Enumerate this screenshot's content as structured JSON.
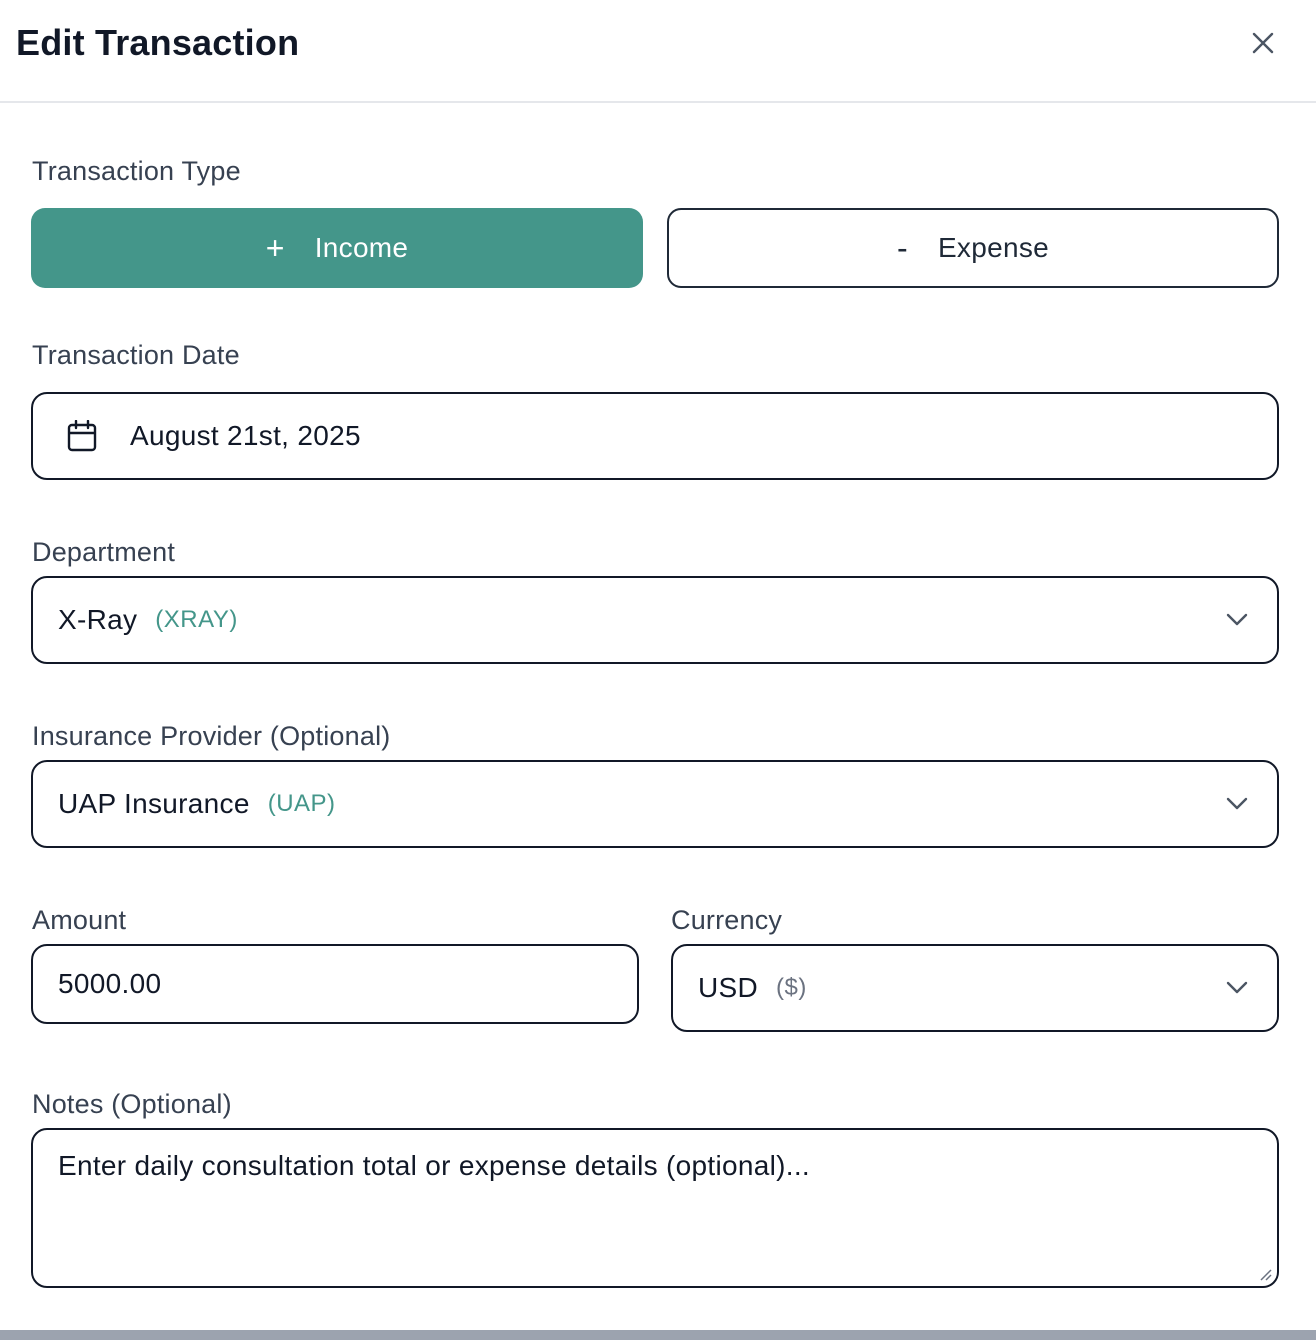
{
  "header": {
    "title": "Edit Transaction",
    "close_icon": "close-icon"
  },
  "form": {
    "type": {
      "label": "Transaction Type",
      "income_label": "Income",
      "income_symbol": "+",
      "expense_label": "Expense",
      "expense_symbol": "-",
      "selected": "Income"
    },
    "date": {
      "label": "Transaction Date",
      "value": "August 21st, 2025",
      "icon": "calendar-icon"
    },
    "department": {
      "label": "Department",
      "value": "X-Ray",
      "code": "(XRAY)"
    },
    "insurance": {
      "label": "Insurance Provider (Optional)",
      "value": "UAP Insurance",
      "code": "(UAP)"
    },
    "amount": {
      "label": "Amount",
      "value": "5000.00"
    },
    "currency": {
      "label": "Currency",
      "value": "USD",
      "symbol": "($)"
    },
    "notes": {
      "label": "Notes (Optional)",
      "placeholder": "Enter daily consultation total or expense details (optional)..."
    }
  },
  "colors": {
    "accent": "#44968a",
    "border": "#111827",
    "label": "#374151"
  }
}
